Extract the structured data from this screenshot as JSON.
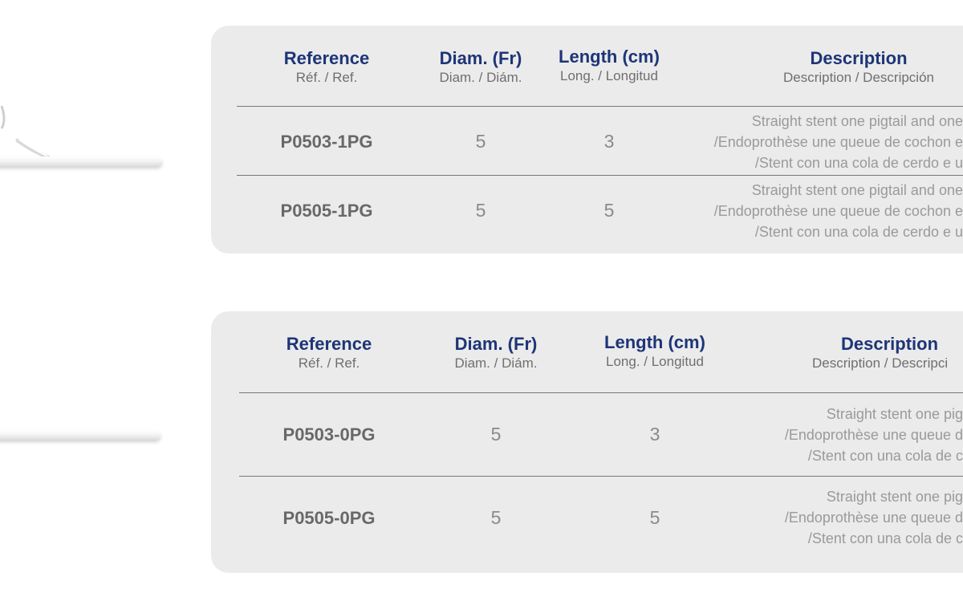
{
  "headers": {
    "reference": {
      "main": "Reference",
      "sub": "Réf. / Ref."
    },
    "diameter": {
      "main": "Diam. (Fr)",
      "sub": "Diam. / Diám."
    },
    "length": {
      "main": "Length (cm)",
      "sub": "Long. / Longitud"
    },
    "description": {
      "main": "Description",
      "sub": "Description / Descripción"
    }
  },
  "table1": {
    "rows": [
      {
        "reference": "P0503-1PG",
        "diameter": "5",
        "length": "3",
        "description": [
          "Straight stent one pigtail and one",
          "/Endoprothèse une queue de cochon e",
          "/Stent con una cola de cerdo e u"
        ]
      },
      {
        "reference": "P0505-1PG",
        "diameter": "5",
        "length": "5",
        "description": [
          "Straight stent one pigtail and one",
          "/Endoprothèse une queue de cochon e",
          "/Stent con una cola de cerdo e u"
        ]
      }
    ]
  },
  "table2": {
    "header_description_sub": "Description / Descripci",
    "rows": [
      {
        "reference": "P0503-0PG",
        "diameter": "5",
        "length": "3",
        "description": [
          "Straight stent one pig",
          "/Endoprothèse une queue d",
          "/Stent con una cola de c"
        ]
      },
      {
        "reference": "P0505-0PG",
        "diameter": "5",
        "length": "5",
        "description": [
          "Straight stent one pig",
          "/Endoprothèse une queue d",
          "/Stent con una cola de c"
        ]
      }
    ]
  },
  "colors": {
    "header_blue": "#1d3577",
    "card_bg": "#ebebeb",
    "text_gray": "#8a8a8a"
  }
}
